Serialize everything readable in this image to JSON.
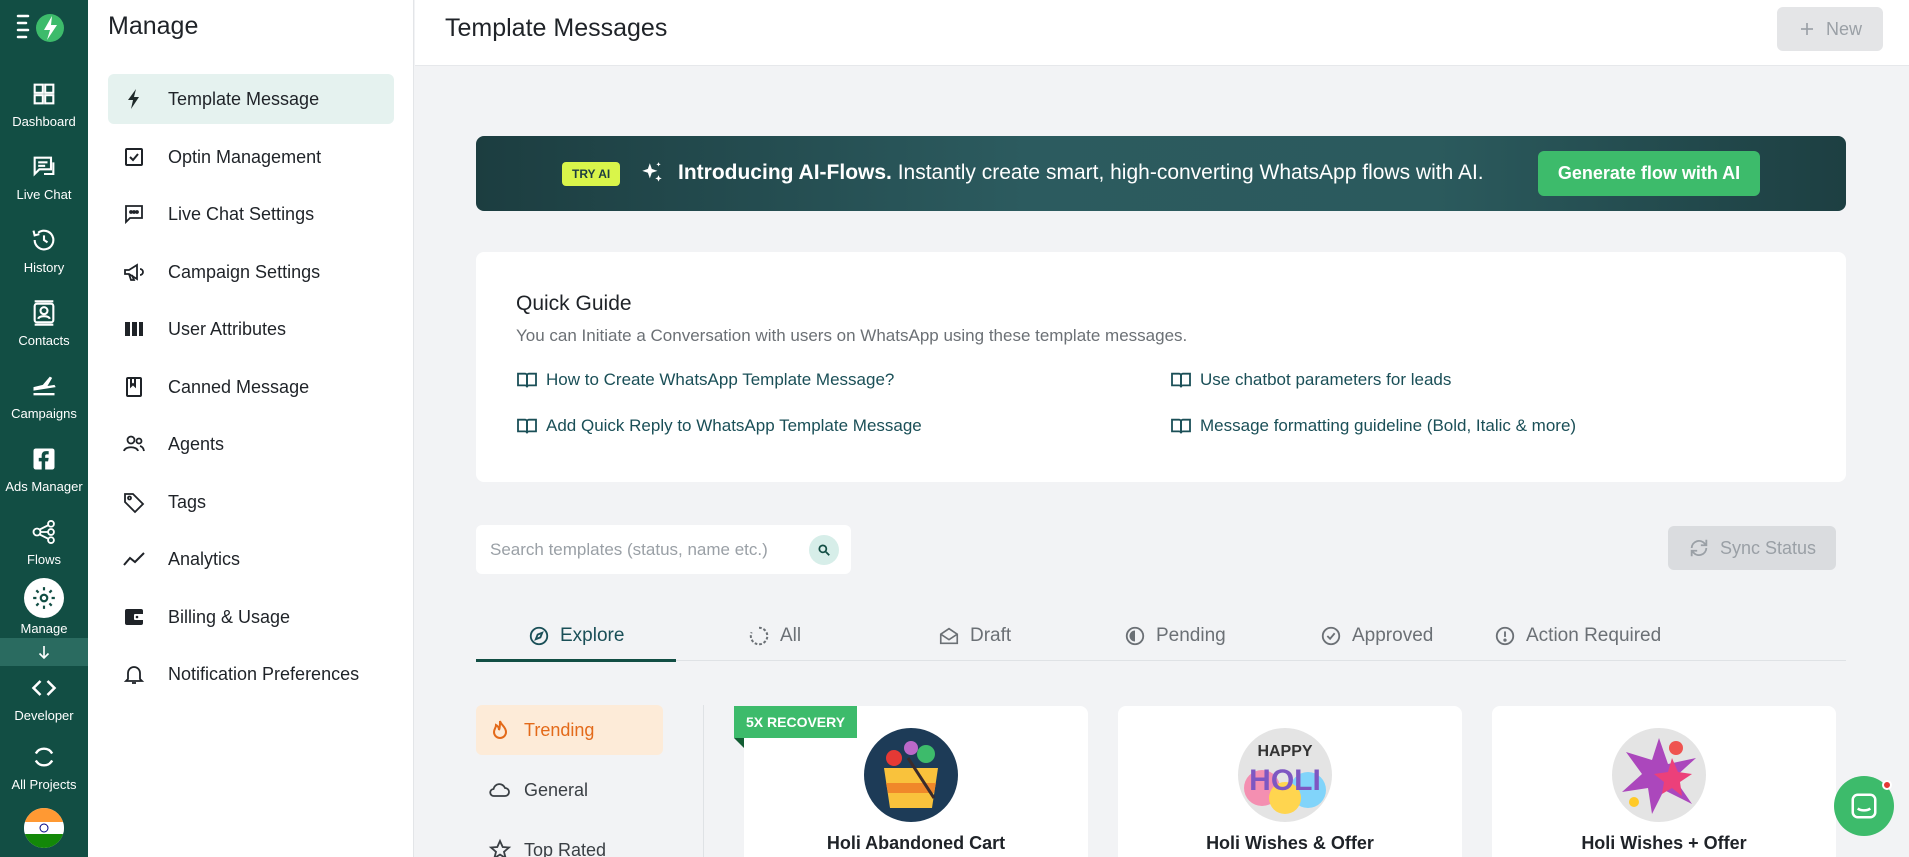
{
  "rail": {
    "items": [
      {
        "label": "Dashboard",
        "icon": "dashboard-icon"
      },
      {
        "label": "Live Chat",
        "icon": "chat-icon"
      },
      {
        "label": "History",
        "icon": "history-icon"
      },
      {
        "label": "Contacts",
        "icon": "contacts-icon"
      },
      {
        "label": "Campaigns",
        "icon": "campaigns-icon"
      },
      {
        "label": "Ads Manager",
        "icon": "facebook-icon"
      },
      {
        "label": "Flows",
        "icon": "flows-icon"
      },
      {
        "label": "Manage",
        "icon": "gear-icon"
      },
      {
        "label": "Developer",
        "icon": "code-icon"
      },
      {
        "label": "All Projects",
        "icon": "projects-icon"
      }
    ]
  },
  "manage": {
    "title": "Manage",
    "items": [
      {
        "label": "Template Message",
        "icon": "lightning-icon"
      },
      {
        "label": "Optin Management",
        "icon": "checkbox-icon"
      },
      {
        "label": "Live Chat Settings",
        "icon": "chat-settings-icon"
      },
      {
        "label": "Campaign Settings",
        "icon": "megaphone-icon"
      },
      {
        "label": "User Attributes",
        "icon": "columns-icon"
      },
      {
        "label": "Canned Message",
        "icon": "bookmark-icon"
      },
      {
        "label": "Agents",
        "icon": "agents-icon"
      },
      {
        "label": "Tags",
        "icon": "tags-icon"
      },
      {
        "label": "Analytics",
        "icon": "analytics-icon"
      },
      {
        "label": "Billing & Usage",
        "icon": "wallet-icon"
      },
      {
        "label": "Notification Preferences",
        "icon": "bell-icon"
      }
    ]
  },
  "header": {
    "title": "Template Messages",
    "new_label": "New"
  },
  "banner": {
    "badge": "TRY AI",
    "headline": "Introducing AI-Flows.",
    "text": " Instantly create smart, high-converting WhatsApp flows with AI.",
    "button": "Generate flow with AI"
  },
  "guide": {
    "title": "Quick Guide",
    "subtitle": "You can Initiate a Conversation with users on WhatsApp using these template messages.",
    "links": [
      "How to Create WhatsApp Template Message?",
      "Use chatbot parameters for leads",
      "Add Quick Reply to WhatsApp Template Message",
      "Message formatting guideline (Bold, Italic & more)"
    ]
  },
  "search": {
    "placeholder": "Search templates (status, name etc.)"
  },
  "sync_label": "Sync Status",
  "tabs": [
    "Explore",
    "All",
    "Draft",
    "Pending",
    "Approved",
    "Action Required"
  ],
  "categories": [
    "Trending",
    "General",
    "Top Rated"
  ],
  "cards": [
    {
      "name": "Holi Abandoned Cart",
      "ribbon": "5X RECOVERY"
    },
    {
      "name": "Holi Wishes & Offer",
      "image_text": "HAPPY HOLI"
    },
    {
      "name": "Holi Wishes + Offer"
    }
  ],
  "colors": {
    "brand": "#124e44",
    "accent_green": "#3dbb6b",
    "trending": "#e36a1a"
  }
}
